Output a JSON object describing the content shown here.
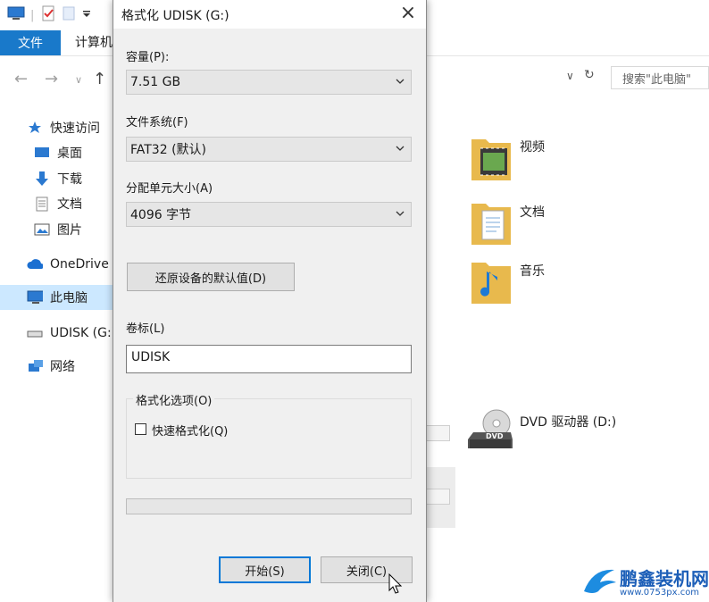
{
  "explorer": {
    "tabs": {
      "file": "文件",
      "computer": "计算机"
    },
    "search_placeholder": "搜索\"此电脑\"",
    "sidebar": [
      {
        "label": "快速访问",
        "icon": "star-icon"
      },
      {
        "label": "桌面",
        "icon": "desktop-icon"
      },
      {
        "label": "下载",
        "icon": "download-icon"
      },
      {
        "label": "文档",
        "icon": "documents-icon"
      },
      {
        "label": "图片",
        "icon": "pictures-icon"
      },
      {
        "label": "OneDrive",
        "icon": "cloud-icon"
      },
      {
        "label": "此电脑",
        "icon": "computer-icon"
      },
      {
        "label": "UDISK (G:)",
        "icon": "usb-drive-icon"
      },
      {
        "label": "网络",
        "icon": "network-icon"
      }
    ],
    "folders": [
      {
        "label": "视频",
        "icon": "videos-folder-icon"
      },
      {
        "label": "文档",
        "icon": "documents-folder-icon"
      },
      {
        "label": "音乐",
        "icon": "music-folder-icon"
      }
    ],
    "dvd_drive": {
      "label": "DVD 驱动器 (D:)",
      "badge": "DVD"
    }
  },
  "dialog": {
    "title": "格式化 UDISK (G:)",
    "capacity_label": "容量(P):",
    "capacity_value": "7.51 GB",
    "filesystem_label": "文件系统(F)",
    "filesystem_value": "FAT32 (默认)",
    "allocation_label": "分配单元大小(A)",
    "allocation_value": "4096 字节",
    "restore_defaults": "还原设备的默认值(D)",
    "volume_label_label": "卷标(L)",
    "volume_label_value": "UDISK",
    "options_group": "格式化选项(O)",
    "quick_format": "快速格式化(Q)",
    "quick_format_checked": false,
    "progress": 0,
    "start_button": "开始(S)",
    "close_button": "关闭(C)"
  },
  "watermark": {
    "brand": "鹏鑫装机网",
    "url": "www.0753px.com"
  }
}
